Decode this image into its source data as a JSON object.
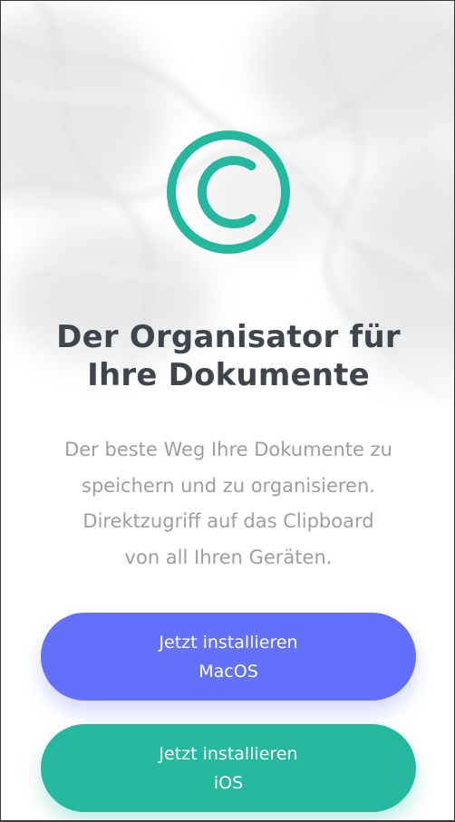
{
  "logo": {
    "icon": "copyright-icon",
    "color": "#24b99e"
  },
  "headline": {
    "line1": "Der Organisator für",
    "line2": "Ihre Dokumente"
  },
  "description": {
    "line1": "Der beste Weg Ihre Dokumente zu",
    "line2": "speichern und zu organisieren.",
    "line3": "Direktzugriff auf das Clipboard",
    "line4": "von all Ihren Geräten."
  },
  "buttons": {
    "macos": {
      "line1": "Jetzt installieren",
      "line2": "MacOS",
      "color": "#6370fa"
    },
    "ios": {
      "line1": "Jetzt installieren",
      "line2": "iOS",
      "color": "#24b99e"
    }
  }
}
